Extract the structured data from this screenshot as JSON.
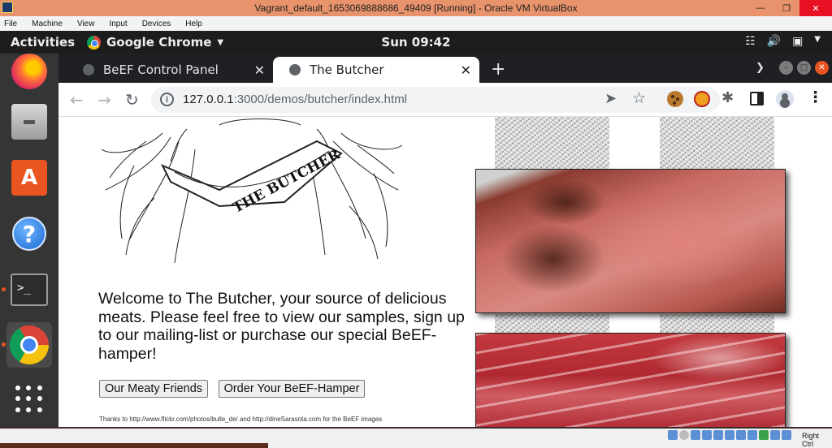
{
  "vbox": {
    "window_title": "Vagrant_default_1653069888686_49409 [Running] - Oracle VM VirtualBox",
    "menu": [
      "File",
      "Machine",
      "View",
      "Input",
      "Devices",
      "Help"
    ],
    "host_key": "Right Ctrl"
  },
  "topbar": {
    "activities": "Activities",
    "app_name": "Google Chrome",
    "clock": "Sun 09:42"
  },
  "dock": {
    "items": [
      "firefox-icon",
      "files-icon",
      "software-icon",
      "help-icon",
      "terminal-icon",
      "chrome-icon",
      "show-apps-icon"
    ]
  },
  "browser": {
    "tabs": [
      {
        "title": "BeEF Control Panel",
        "active": false
      },
      {
        "title": "The Butcher",
        "active": true
      }
    ],
    "url_host": "127.0.0.1",
    "url_path": ":3000/demos/butcher/index.html"
  },
  "page": {
    "logo_text": "THE BUTCHER",
    "welcome": "Welcome to The Butcher, your source of delicious meats. Please feel free to view our samples, sign up to our mailing-list or purchase our special BeEF-hamper!",
    "buttons": {
      "friends": "Our Meaty Friends",
      "hamper": "Order Your BeEF-Hamper"
    },
    "thanks": "Thanks to http://www.flickr.com/photos/bulle_de/ and http://dineSarasota.com for the BeEF images"
  },
  "colors": {
    "vbox_title_bg": "#e8936b",
    "ubuntu_accent": "#e95420",
    "tabstrip_bg": "#1f2024"
  }
}
